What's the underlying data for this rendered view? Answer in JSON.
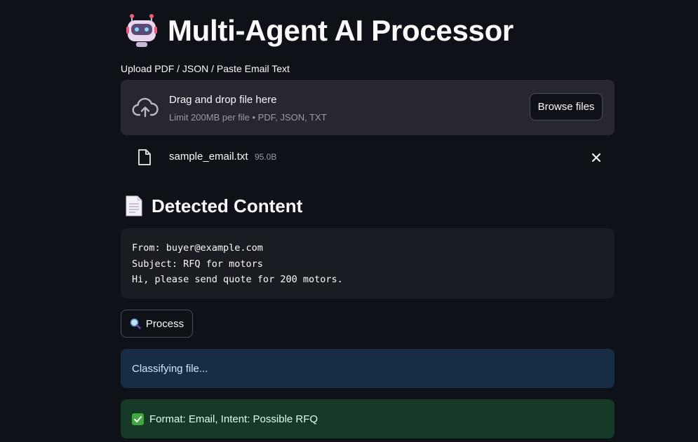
{
  "header": {
    "title": "Multi-Agent AI Processor",
    "icon": "robot-icon"
  },
  "uploader": {
    "label": "Upload PDF / JSON / Paste Email Text",
    "drop_title": "Drag and drop file here",
    "limit_text": "Limit 200MB per file • PDF, JSON, TXT",
    "browse_label": "Browse files",
    "icon": "cloud-upload-icon"
  },
  "uploaded_file": {
    "name": "sample_email.txt",
    "size": "95.0B",
    "icon": "file-icon",
    "remove_icon": "close-icon"
  },
  "detected": {
    "title": "Detected Content",
    "icon": "page-icon",
    "lines": [
      "From: buyer@example.com",
      "Subject: RFQ for motors",
      "Hi, please send quote for 200 motors."
    ]
  },
  "process_button": {
    "label": "Process",
    "icon": "magnifier-icon"
  },
  "status": {
    "info_text": "Classifying file...",
    "success_text": "Format: Email, Intent: Possible RFQ",
    "success_icon": "check-icon"
  },
  "colors": {
    "background": "#0e1117",
    "panel": "#262730",
    "code_bg": "#1a1c24",
    "info_bg": "#172d43",
    "info_text": "#c7ebff",
    "success_bg": "#173928",
    "success_text": "#dffde9"
  }
}
